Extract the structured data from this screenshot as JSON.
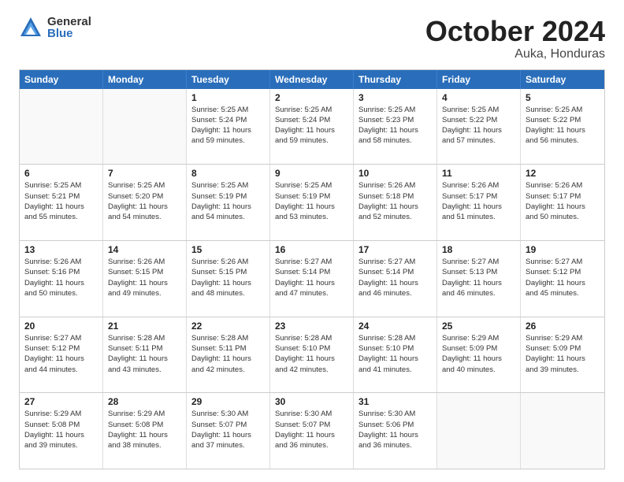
{
  "logo": {
    "general": "General",
    "blue": "Blue"
  },
  "title": {
    "month": "October 2024",
    "location": "Auka, Honduras"
  },
  "calendar": {
    "headers": [
      "Sunday",
      "Monday",
      "Tuesday",
      "Wednesday",
      "Thursday",
      "Friday",
      "Saturday"
    ],
    "rows": [
      [
        {
          "day": "",
          "info": ""
        },
        {
          "day": "",
          "info": ""
        },
        {
          "day": "1",
          "info": "Sunrise: 5:25 AM\nSunset: 5:24 PM\nDaylight: 11 hours and 59 minutes."
        },
        {
          "day": "2",
          "info": "Sunrise: 5:25 AM\nSunset: 5:24 PM\nDaylight: 11 hours and 59 minutes."
        },
        {
          "day": "3",
          "info": "Sunrise: 5:25 AM\nSunset: 5:23 PM\nDaylight: 11 hours and 58 minutes."
        },
        {
          "day": "4",
          "info": "Sunrise: 5:25 AM\nSunset: 5:22 PM\nDaylight: 11 hours and 57 minutes."
        },
        {
          "day": "5",
          "info": "Sunrise: 5:25 AM\nSunset: 5:22 PM\nDaylight: 11 hours and 56 minutes."
        }
      ],
      [
        {
          "day": "6",
          "info": "Sunrise: 5:25 AM\nSunset: 5:21 PM\nDaylight: 11 hours and 55 minutes."
        },
        {
          "day": "7",
          "info": "Sunrise: 5:25 AM\nSunset: 5:20 PM\nDaylight: 11 hours and 54 minutes."
        },
        {
          "day": "8",
          "info": "Sunrise: 5:25 AM\nSunset: 5:19 PM\nDaylight: 11 hours and 54 minutes."
        },
        {
          "day": "9",
          "info": "Sunrise: 5:25 AM\nSunset: 5:19 PM\nDaylight: 11 hours and 53 minutes."
        },
        {
          "day": "10",
          "info": "Sunrise: 5:26 AM\nSunset: 5:18 PM\nDaylight: 11 hours and 52 minutes."
        },
        {
          "day": "11",
          "info": "Sunrise: 5:26 AM\nSunset: 5:17 PM\nDaylight: 11 hours and 51 minutes."
        },
        {
          "day": "12",
          "info": "Sunrise: 5:26 AM\nSunset: 5:17 PM\nDaylight: 11 hours and 50 minutes."
        }
      ],
      [
        {
          "day": "13",
          "info": "Sunrise: 5:26 AM\nSunset: 5:16 PM\nDaylight: 11 hours and 50 minutes."
        },
        {
          "day": "14",
          "info": "Sunrise: 5:26 AM\nSunset: 5:15 PM\nDaylight: 11 hours and 49 minutes."
        },
        {
          "day": "15",
          "info": "Sunrise: 5:26 AM\nSunset: 5:15 PM\nDaylight: 11 hours and 48 minutes."
        },
        {
          "day": "16",
          "info": "Sunrise: 5:27 AM\nSunset: 5:14 PM\nDaylight: 11 hours and 47 minutes."
        },
        {
          "day": "17",
          "info": "Sunrise: 5:27 AM\nSunset: 5:14 PM\nDaylight: 11 hours and 46 minutes."
        },
        {
          "day": "18",
          "info": "Sunrise: 5:27 AM\nSunset: 5:13 PM\nDaylight: 11 hours and 46 minutes."
        },
        {
          "day": "19",
          "info": "Sunrise: 5:27 AM\nSunset: 5:12 PM\nDaylight: 11 hours and 45 minutes."
        }
      ],
      [
        {
          "day": "20",
          "info": "Sunrise: 5:27 AM\nSunset: 5:12 PM\nDaylight: 11 hours and 44 minutes."
        },
        {
          "day": "21",
          "info": "Sunrise: 5:28 AM\nSunset: 5:11 PM\nDaylight: 11 hours and 43 minutes."
        },
        {
          "day": "22",
          "info": "Sunrise: 5:28 AM\nSunset: 5:11 PM\nDaylight: 11 hours and 42 minutes."
        },
        {
          "day": "23",
          "info": "Sunrise: 5:28 AM\nSunset: 5:10 PM\nDaylight: 11 hours and 42 minutes."
        },
        {
          "day": "24",
          "info": "Sunrise: 5:28 AM\nSunset: 5:10 PM\nDaylight: 11 hours and 41 minutes."
        },
        {
          "day": "25",
          "info": "Sunrise: 5:29 AM\nSunset: 5:09 PM\nDaylight: 11 hours and 40 minutes."
        },
        {
          "day": "26",
          "info": "Sunrise: 5:29 AM\nSunset: 5:09 PM\nDaylight: 11 hours and 39 minutes."
        }
      ],
      [
        {
          "day": "27",
          "info": "Sunrise: 5:29 AM\nSunset: 5:08 PM\nDaylight: 11 hours and 39 minutes."
        },
        {
          "day": "28",
          "info": "Sunrise: 5:29 AM\nSunset: 5:08 PM\nDaylight: 11 hours and 38 minutes."
        },
        {
          "day": "29",
          "info": "Sunrise: 5:30 AM\nSunset: 5:07 PM\nDaylight: 11 hours and 37 minutes."
        },
        {
          "day": "30",
          "info": "Sunrise: 5:30 AM\nSunset: 5:07 PM\nDaylight: 11 hours and 36 minutes."
        },
        {
          "day": "31",
          "info": "Sunrise: 5:30 AM\nSunset: 5:06 PM\nDaylight: 11 hours and 36 minutes."
        },
        {
          "day": "",
          "info": ""
        },
        {
          "day": "",
          "info": ""
        }
      ]
    ]
  }
}
